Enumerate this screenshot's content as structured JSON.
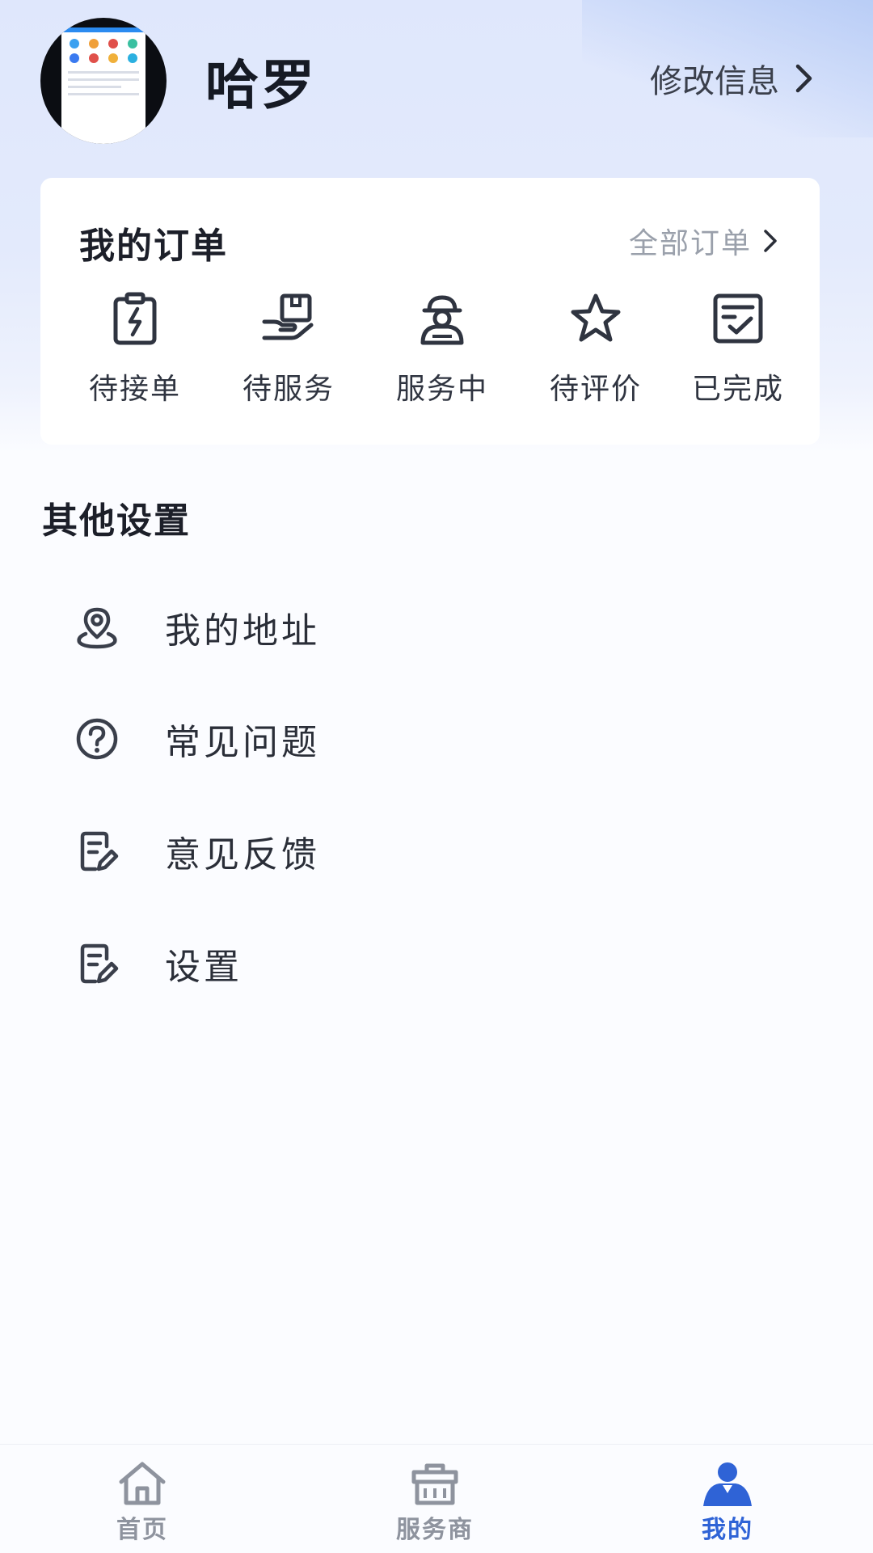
{
  "profile": {
    "username": "哈罗",
    "edit_label": "修改信息"
  },
  "orders": {
    "title": "我的订单",
    "all_label": "全部订单",
    "items": [
      {
        "label": "待接单",
        "icon": "clipboard-lightning-icon"
      },
      {
        "label": "待服务",
        "icon": "hand-box-icon"
      },
      {
        "label": "服务中",
        "icon": "worker-icon"
      },
      {
        "label": "待评价",
        "icon": "star-icon"
      },
      {
        "label": "已完成",
        "icon": "checked-list-icon"
      }
    ]
  },
  "settings": {
    "title": "其他设置",
    "items": [
      {
        "label": "我的地址",
        "icon": "location-pin-icon"
      },
      {
        "label": "常见问题",
        "icon": "question-circle-icon"
      },
      {
        "label": "意见反馈",
        "icon": "edit-document-icon"
      },
      {
        "label": "设置",
        "icon": "edit-document-icon"
      }
    ]
  },
  "tabbar": {
    "items": [
      {
        "label": "首页",
        "icon": "home-icon",
        "active": false
      },
      {
        "label": "服务商",
        "icon": "shop-icon",
        "active": false
      },
      {
        "label": "我的",
        "icon": "user-icon",
        "active": true
      }
    ]
  },
  "colors": {
    "accent": "#2f63d6",
    "header_bg": "#dfe7fc",
    "icon": "#3a3f4b",
    "inactive_tab": "#8e939e"
  }
}
